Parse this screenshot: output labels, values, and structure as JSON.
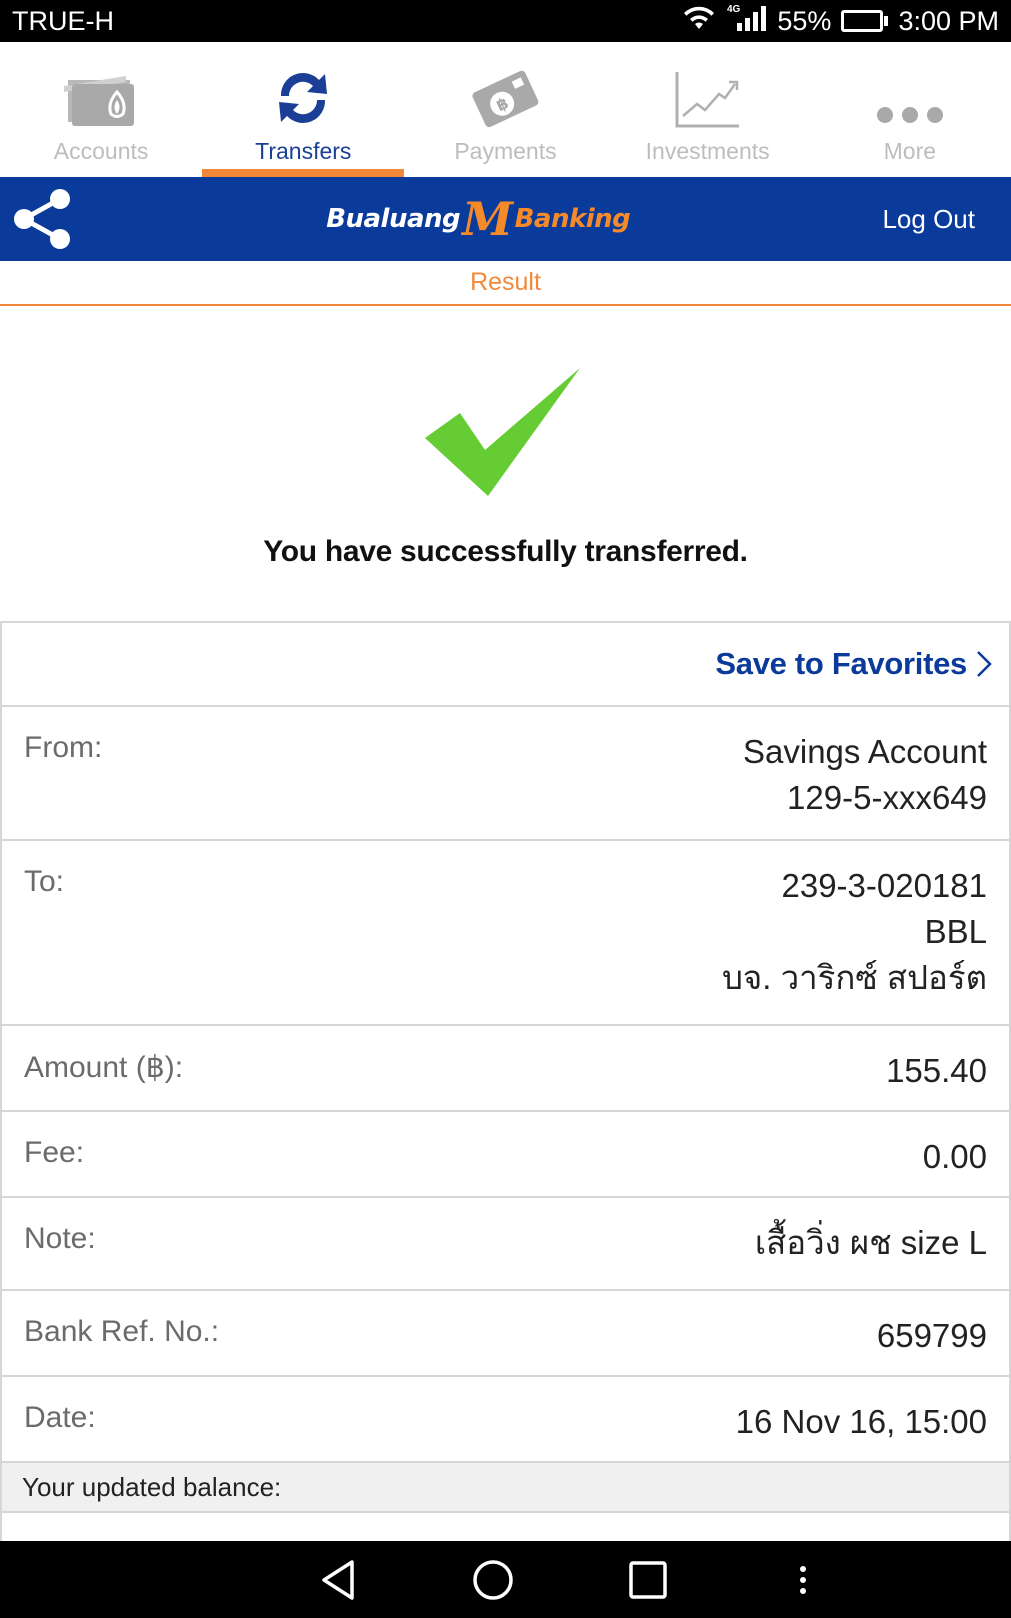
{
  "status_bar": {
    "carrier": "TRUE-H",
    "network": "4G",
    "battery": "55%",
    "battery_level": 0.55,
    "time": "3:00 PM"
  },
  "tabs": [
    {
      "label": "Accounts",
      "icon": "wallet-icon",
      "active": false
    },
    {
      "label": "Transfers",
      "icon": "transfer-arrows-icon",
      "active": true
    },
    {
      "label": "Payments",
      "icon": "baht-card-icon",
      "active": false
    },
    {
      "label": "Investments",
      "icon": "chart-line-icon",
      "active": false
    },
    {
      "label": "More",
      "icon": "more-dots-icon",
      "active": false
    }
  ],
  "header": {
    "logo_left": "Bualuang",
    "logo_m": "M",
    "logo_right": "Banking",
    "logout": "Log Out"
  },
  "sub_header": {
    "title": "Result"
  },
  "success": {
    "message": "You have successfully transferred."
  },
  "favorites": {
    "label": "Save to Favorites"
  },
  "details": {
    "from": {
      "label": "From:",
      "line1": "Savings Account",
      "line2": "129-5-xxx649"
    },
    "to": {
      "label": "To:",
      "line1": "239-3-020181",
      "line2": "BBL",
      "line3": "บจ. วาริกซ์ สปอร์ต"
    },
    "amount": {
      "label": "Amount (฿):",
      "value": "155.40"
    },
    "fee": {
      "label": "Fee:",
      "value": "0.00"
    },
    "note": {
      "label": "Note:",
      "value": "เสื้อวิ่ง ผช size L"
    },
    "ref": {
      "label": "Bank Ref. No.:",
      "value": "659799"
    },
    "date": {
      "label": "Date:",
      "value": "16 Nov 16, 15:00"
    }
  },
  "balance": {
    "label": "Your updated balance:"
  },
  "colors": {
    "brand_blue": "#0a3a9a",
    "accent_orange": "#f2893a",
    "success_green": "#66cc33"
  }
}
